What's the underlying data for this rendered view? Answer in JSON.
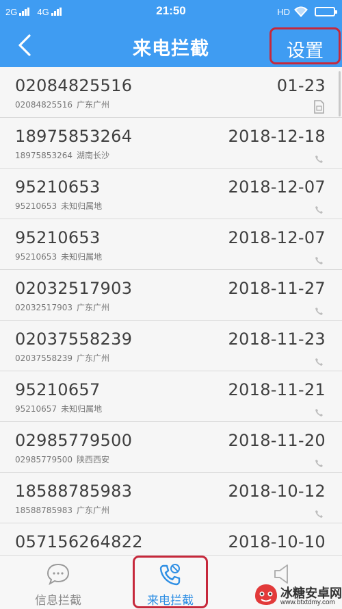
{
  "status_bar": {
    "network1": "2G",
    "network2": "4G",
    "time": "21:50",
    "hd": "HD"
  },
  "header": {
    "title": "来电拦截",
    "settings_label": "设置"
  },
  "calls": [
    {
      "number": "02084825516",
      "date": "01-23",
      "sub_number": "02084825516",
      "location": "广东广州",
      "icon": "sim-icon"
    },
    {
      "number": "18975853264",
      "date": "2018-12-18",
      "sub_number": "18975853264",
      "location": "湖南长沙",
      "icon": "phone-icon"
    },
    {
      "number": "95210653",
      "date": "2018-12-07",
      "sub_number": "95210653",
      "location": "未知归属地",
      "icon": "phone-icon"
    },
    {
      "number": "95210653",
      "date": "2018-12-07",
      "sub_number": "95210653",
      "location": "未知归属地",
      "icon": "phone-icon"
    },
    {
      "number": "02032517903",
      "date": "2018-11-27",
      "sub_number": "02032517903",
      "location": "广东广州",
      "icon": "phone-icon"
    },
    {
      "number": "02037558239",
      "date": "2018-11-23",
      "sub_number": "02037558239",
      "location": "广东广州",
      "icon": "phone-icon"
    },
    {
      "number": "95210657",
      "date": "2018-11-21",
      "sub_number": "95210657",
      "location": "未知归属地",
      "icon": "phone-icon"
    },
    {
      "number": "02985779500",
      "date": "2018-11-20",
      "sub_number": "02985779500",
      "location": "陕西西安",
      "icon": "phone-icon"
    },
    {
      "number": "18588785983",
      "date": "2018-10-12",
      "sub_number": "18588785983",
      "location": "广东广州",
      "icon": "phone-icon"
    },
    {
      "number": "057156264822",
      "date": "2018-10-10",
      "sub_number": "",
      "location": "",
      "icon": "phone-icon"
    }
  ],
  "tabs": [
    {
      "label": "信息拦截",
      "icon": "message-block-icon",
      "active": false
    },
    {
      "label": "来电拦截",
      "icon": "call-block-icon",
      "active": true
    },
    {
      "label": "",
      "icon": "speaker-icon",
      "active": false
    }
  ],
  "watermark": {
    "text": "冰糖安卓网",
    "url": "www.btxtdmy.com"
  },
  "colors": {
    "header_bg": "#3f9cf2",
    "highlight_border": "#c6283b",
    "active_tab": "#2f8fe4"
  }
}
